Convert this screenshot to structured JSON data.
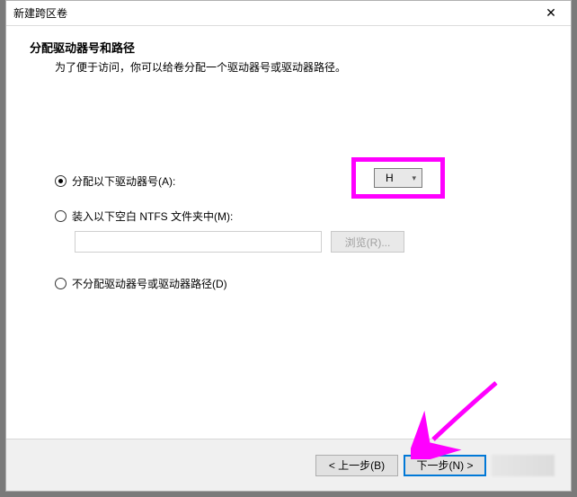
{
  "window": {
    "title": "新建跨区卷",
    "close_symbol": "✕"
  },
  "header": {
    "heading": "分配驱动器号和路径",
    "subheading": "为了便于访问，你可以给卷分配一个驱动器号或驱动器路径。"
  },
  "options": {
    "assign_letter": {
      "label": "分配以下驱动器号(A):",
      "selected": true
    },
    "drive_letter": "H",
    "mount_folder": {
      "label": "装入以下空白 NTFS 文件夹中(M):",
      "selected": false
    },
    "path_value": "",
    "browse_label": "浏览(R)...",
    "no_assign": {
      "label": "不分配驱动器号或驱动器路径(D)",
      "selected": false
    }
  },
  "footer": {
    "back": "< 上一步(B)",
    "next": "下一步(N) >"
  },
  "annotation": {
    "highlight_color": "#ff00ff"
  }
}
